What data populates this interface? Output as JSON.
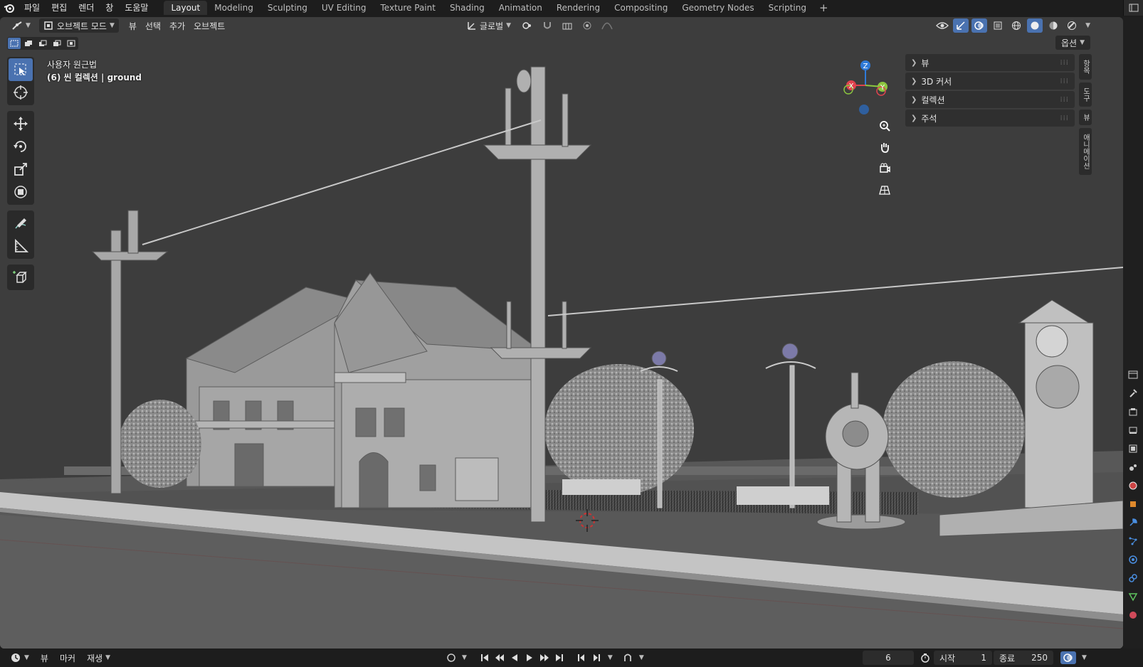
{
  "menu": [
    "파일",
    "편집",
    "렌더",
    "창",
    "도움말"
  ],
  "workspaces": [
    "Layout",
    "Modeling",
    "Sculpting",
    "UV Editing",
    "Texture Paint",
    "Shading",
    "Animation",
    "Rendering",
    "Compositing",
    "Geometry Nodes",
    "Scripting"
  ],
  "workspace_add": "+",
  "header": {
    "mode": "오브젝트 모드",
    "menus": [
      "뷰",
      "선택",
      "추가",
      "오브젝트"
    ],
    "transform_orientation": "글로벌",
    "options": "옵션"
  },
  "overlay": {
    "view_name": "사용자 원근법",
    "collection": "(6) 씬 컬렉션 | ground"
  },
  "gizmo": {
    "x": "X",
    "y": "Y",
    "z": "Z"
  },
  "npanel": {
    "items": [
      "뷰",
      "3D 커서",
      "컬렉션",
      "주석"
    ],
    "tabs": [
      "항목",
      "도구",
      "뷰",
      "애니메이션"
    ]
  },
  "timeline": {
    "menus": [
      "뷰",
      "마커",
      "재생"
    ],
    "current_frame": "6",
    "start_label": "시작",
    "start": "1",
    "end_label": "종료",
    "end": "250"
  },
  "colors": {
    "accent": "#4a72b0",
    "axis_x": "#e0434e",
    "axis_y": "#8cc63f",
    "axis_z": "#2f7ad8"
  }
}
